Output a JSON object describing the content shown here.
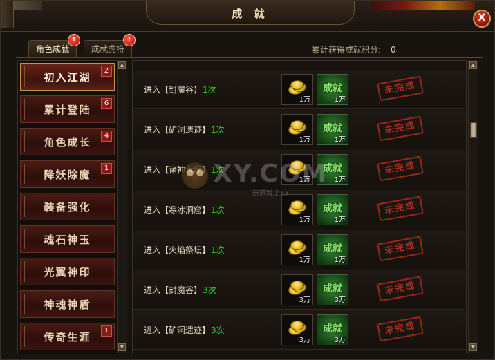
{
  "window": {
    "title": "成 就",
    "close_label": "X"
  },
  "tabs": [
    {
      "label": "角色成就",
      "badge": "!"
    },
    {
      "label": "成就虎符",
      "badge": "!"
    }
  ],
  "score": {
    "label": "累计获得成就积分:",
    "value": "0"
  },
  "sidebar": {
    "items": [
      {
        "label": "初入江湖",
        "count": "2"
      },
      {
        "label": "累计登陆",
        "count": "6"
      },
      {
        "label": "角色成长",
        "count": "4"
      },
      {
        "label": "降妖除魔",
        "count": "1"
      },
      {
        "label": "装备强化",
        "count": ""
      },
      {
        "label": "魂石神玉",
        "count": ""
      },
      {
        "label": "光翼神印",
        "count": ""
      },
      {
        "label": "神魂神盾",
        "count": ""
      },
      {
        "label": "传奇生涯",
        "count": "1"
      }
    ]
  },
  "achievements": [
    {
      "prefix": "进入",
      "location": "【封魔谷】",
      "times": "1次",
      "gold": "1万",
      "achieve_label": "成就",
      "achieve_amount": "1万",
      "status": "未完成"
    },
    {
      "prefix": "进入",
      "location": "【矿洞遗迹】",
      "times": "1次",
      "gold": "1万",
      "achieve_label": "成就",
      "achieve_amount": "1万",
      "status": "未完成"
    },
    {
      "prefix": "进入",
      "location": "【诸神大厅】",
      "times": "1次",
      "gold": "1万",
      "achieve_label": "成就",
      "achieve_amount": "1万",
      "status": "未完成"
    },
    {
      "prefix": "进入",
      "location": "【寒冰洞窟】",
      "times": "1次",
      "gold": "1万",
      "achieve_label": "成就",
      "achieve_amount": "1万",
      "status": "未完成"
    },
    {
      "prefix": "进入",
      "location": "【火焰祭坛】",
      "times": "1次",
      "gold": "1万",
      "achieve_label": "成就",
      "achieve_amount": "1万",
      "status": "未完成"
    },
    {
      "prefix": "进入",
      "location": "【封魔谷】",
      "times": "3次",
      "gold": "3万",
      "achieve_label": "成就",
      "achieve_amount": "3万",
      "status": "未完成"
    },
    {
      "prefix": "进入",
      "location": "【矿洞遗迹】",
      "times": "3次",
      "gold": "3万",
      "achieve_label": "成就",
      "achieve_amount": "3万",
      "status": "未完成"
    }
  ],
  "watermark": {
    "big": "XY.COM",
    "small": "玩游戏上XY"
  },
  "colors": {
    "completed_times": "#2bd41c",
    "stamp": "#c43420",
    "achievement_green": "#8ef070"
  }
}
